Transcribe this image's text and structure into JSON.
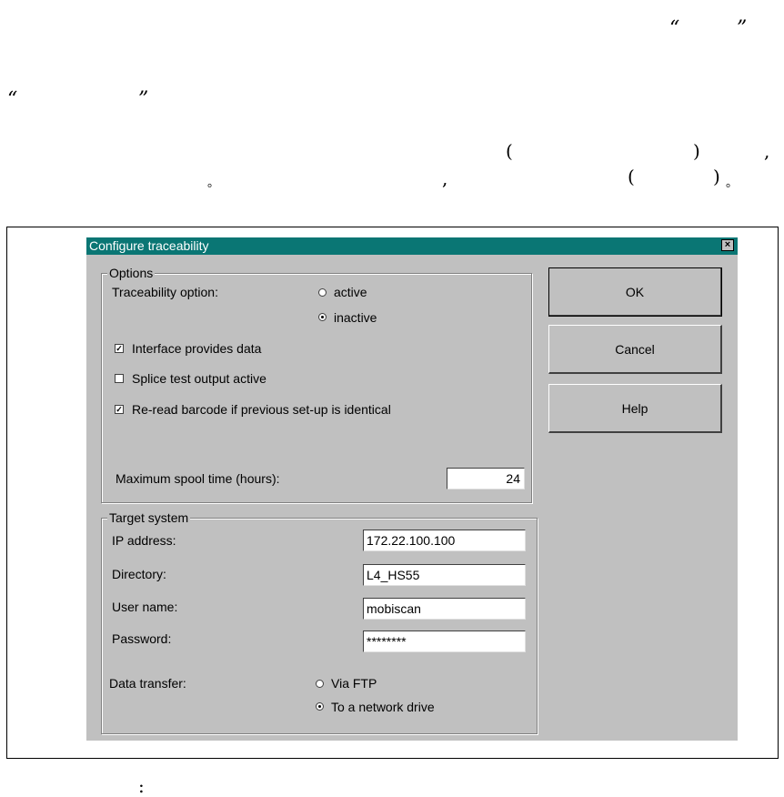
{
  "page_glyphs": {
    "quote_open_1": "“",
    "quote_close_1": "”",
    "quote_open_2": "“",
    "quote_close_2": "”",
    "paren_open_1": "(",
    "paren_close_1": ")",
    "comma_1": ",",
    "period_1": "。",
    "comma_2": ",",
    "paren_open_2": "(",
    "paren_close_2": ")",
    "period_2": "。",
    "colon": ":"
  },
  "dialog": {
    "title": "Configure traceability",
    "close_symbol": "×",
    "options": {
      "group_label": "Options",
      "traceability_label": "Traceability option:",
      "radio_active": "active",
      "radio_inactive": "inactive",
      "traceability_selected": "inactive",
      "check_interface": "Interface provides data",
      "check_interface_checked": true,
      "check_splice": "Splice test output active",
      "check_splice_checked": false,
      "check_reread": "Re-read barcode if previous set-up is identical",
      "check_reread_checked": true,
      "spool_label": "Maximum spool time (hours):",
      "spool_value": "24"
    },
    "target": {
      "group_label": "Target system",
      "ip_label": "IP address:",
      "ip_value": "172.22.100.100",
      "directory_label": "Directory:",
      "directory_value": "L4_HS55",
      "user_label": "User name:",
      "user_value": "mobiscan",
      "password_label": "Password:",
      "password_value": "********",
      "transfer_label": "Data transfer:",
      "radio_ftp": "Via FTP",
      "radio_network": "To a network drive",
      "transfer_selected": "network"
    },
    "buttons": {
      "ok": "OK",
      "cancel": "Cancel",
      "help": "Help"
    }
  },
  "colors": {
    "titlebar": "#0a7674",
    "dialog_bg": "#c0c0c0"
  }
}
